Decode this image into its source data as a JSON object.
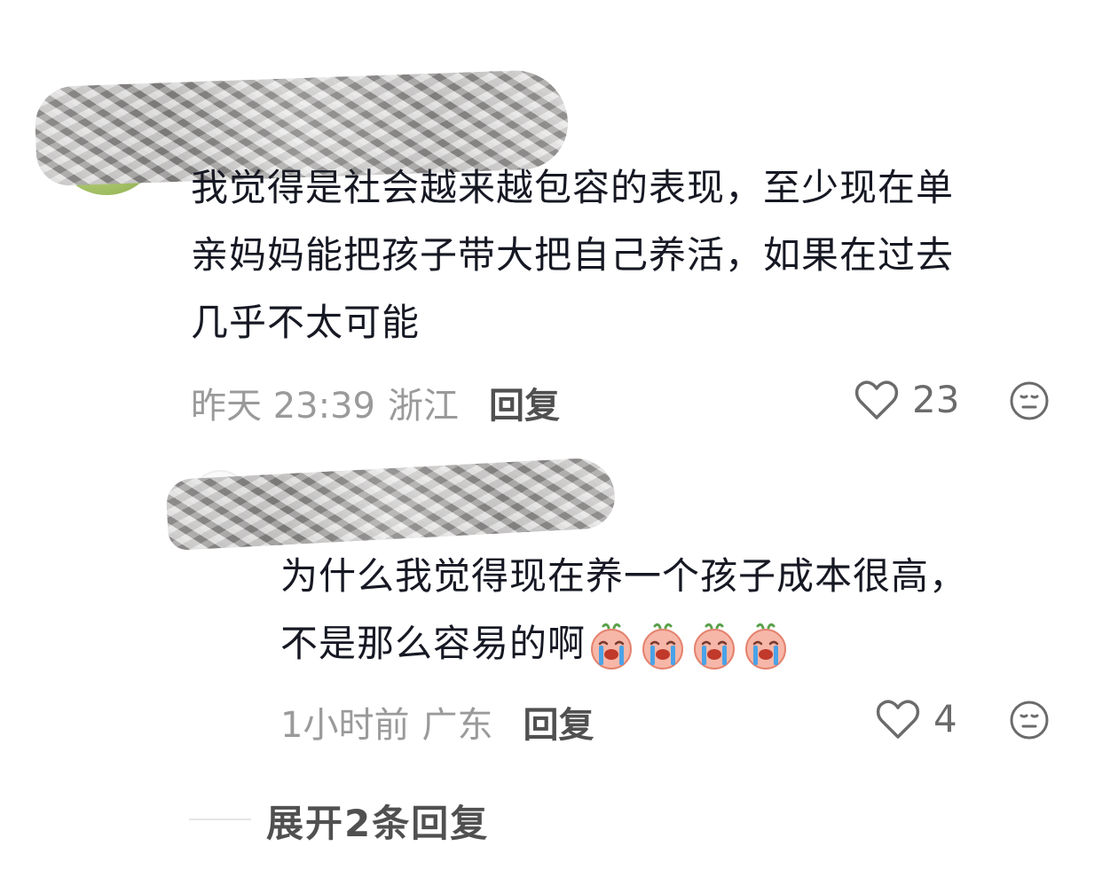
{
  "comments": [
    {
      "text_lines": [
        "我觉得是社会越来越包容的表现，至少现在单",
        "亲妈妈能把孩子带大把自己养活，如果在过去",
        "几乎不太可能"
      ],
      "time": "昨天 23:39",
      "location": "浙江",
      "reply_label": "回复",
      "likes": "23"
    }
  ],
  "reply": {
    "text_lines": [
      "为什么我觉得现在养一个孩子成本很高，",
      "不是那么容易的啊"
    ],
    "emoji_count": 4,
    "time": "1小时前",
    "location": "广东",
    "reply_label": "回复",
    "likes": "4"
  },
  "expand": {
    "label": "展开2条回复"
  },
  "icons": {
    "like": "heart-outline-icon",
    "expression": "neutral-face-icon",
    "crying": "crying-face-emoji"
  },
  "colors": {
    "text": "#161823",
    "meta": "#9a9a9a",
    "action": "#505050"
  }
}
